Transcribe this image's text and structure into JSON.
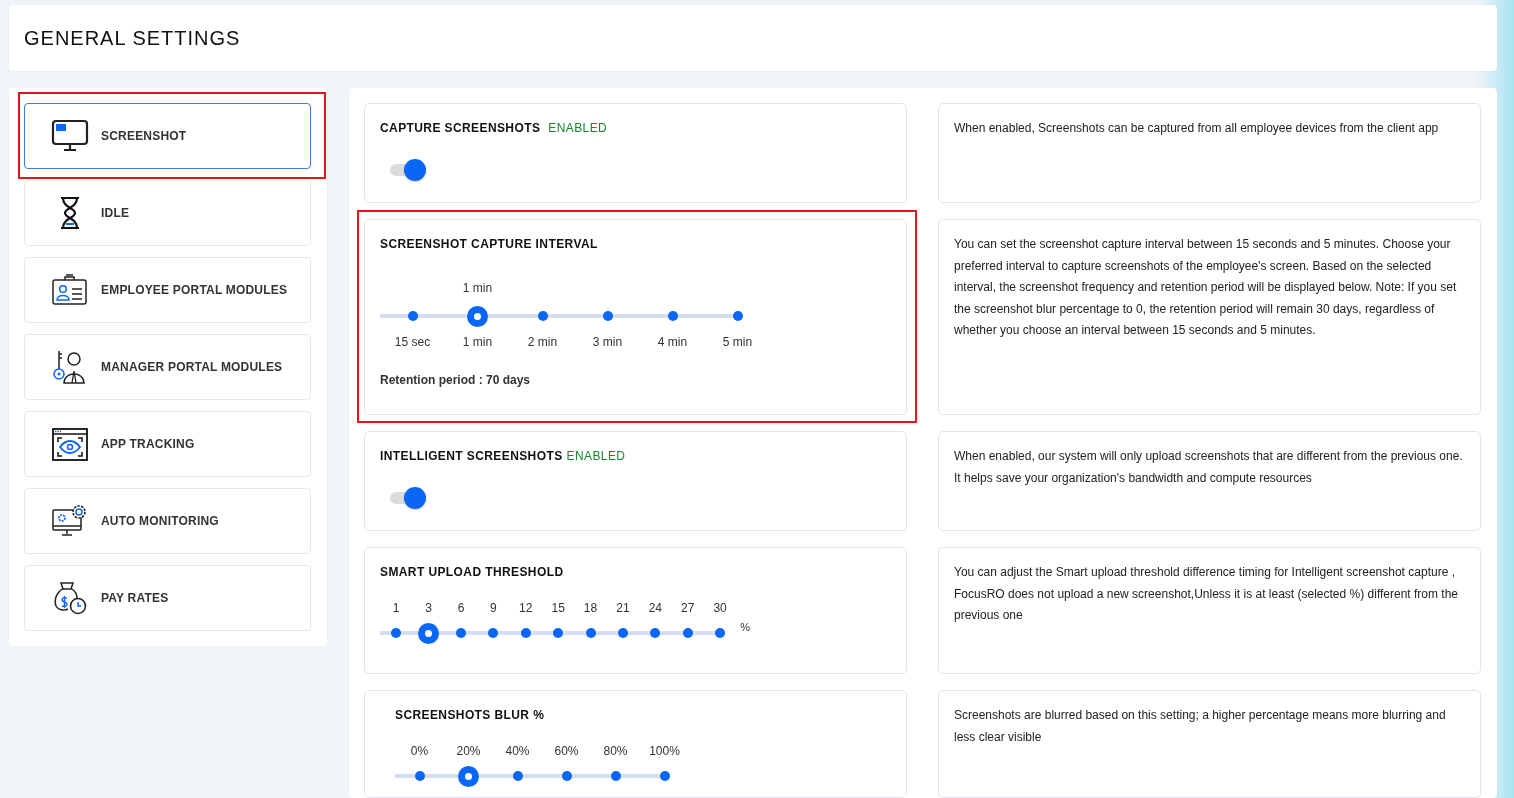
{
  "header": {
    "title": "GENERAL SETTINGS"
  },
  "sidebar": {
    "items": [
      {
        "label": "SCREENSHOT",
        "selected": true,
        "highlighted": true
      },
      {
        "label": "IDLE",
        "selected": false,
        "highlighted": false
      },
      {
        "label": "EMPLOYEE PORTAL MODULES",
        "selected": false,
        "highlighted": false
      },
      {
        "label": "MANAGER PORTAL MODULES",
        "selected": false,
        "highlighted": false
      },
      {
        "label": "APP TRACKING",
        "selected": false,
        "highlighted": false
      },
      {
        "label": "AUTO MONITORING",
        "selected": false,
        "highlighted": false
      },
      {
        "label": "PAY RATES",
        "selected": false,
        "highlighted": false
      }
    ]
  },
  "settings": [
    {
      "kind": "toggle",
      "title": "CAPTURE SCREENSHOTS",
      "status": "ENABLED",
      "on": true,
      "highlighted": false,
      "description": "When enabled, Screenshots can be captured from all employee devices from the client app"
    },
    {
      "kind": "interval",
      "title": "SCREENSHOT CAPTURE INTERVAL",
      "highlighted": true,
      "value_label": "1 min",
      "steps": [
        {
          "label": "15 sec",
          "selected": false
        },
        {
          "label": "1 min",
          "selected": true
        },
        {
          "label": "2 min",
          "selected": false
        },
        {
          "label": "3 min",
          "selected": false
        },
        {
          "label": "4 min",
          "selected": false
        },
        {
          "label": "5 min",
          "selected": false
        }
      ],
      "note": "Retention period : 70 days",
      "description": "You can set the screenshot capture interval between 15 seconds and 5 minutes. Choose your preferred interval to capture screenshots of the employee's screen. Based on the selected interval, the screenshot frequency and retention period will be displayed below. Note: If you set the screenshot blur percentage to 0, the retention period will remain 30 days, regardless of whether you choose an interval between 15 seconds and 5 minutes."
    },
    {
      "kind": "toggle",
      "title": "INTELLIGENT SCREENSHOTS",
      "status": "ENABLED",
      "on": true,
      "highlighted": false,
      "description": "When enabled, our system will only upload screenshots that are different from the previous one. It helps save your organization's bandwidth and compute resources"
    },
    {
      "kind": "threshold",
      "title": "SMART UPLOAD THRESHOLD",
      "highlighted": false,
      "unit": "%",
      "steps": [
        {
          "label": "1",
          "selected": false
        },
        {
          "label": "3",
          "selected": true
        },
        {
          "label": "6",
          "selected": false
        },
        {
          "label": "9",
          "selected": false
        },
        {
          "label": "12",
          "selected": false
        },
        {
          "label": "15",
          "selected": false
        },
        {
          "label": "18",
          "selected": false
        },
        {
          "label": "21",
          "selected": false
        },
        {
          "label": "24",
          "selected": false
        },
        {
          "label": "27",
          "selected": false
        },
        {
          "label": "30",
          "selected": false
        }
      ],
      "description": "You can adjust the Smart upload threshold difference timing for Intelligent screenshot capture , FocusRO does not upload a new screenshot,Unless it is at least (selected %) different from the previous one"
    },
    {
      "kind": "percent",
      "title": "SCREENSHOTS BLUR %",
      "highlighted": false,
      "steps": [
        {
          "label": "0%",
          "selected": false
        },
        {
          "label": "20%",
          "selected": true
        },
        {
          "label": "40%",
          "selected": false
        },
        {
          "label": "60%",
          "selected": false
        },
        {
          "label": "80%",
          "selected": false
        },
        {
          "label": "100%",
          "selected": false
        }
      ],
      "description": "Screenshots are blurred based on this setting; a higher percentage means more blurring and less clear visible"
    }
  ]
}
